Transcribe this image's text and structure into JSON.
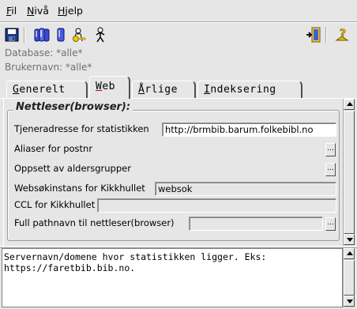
{
  "menu": {
    "file": {
      "u": "F",
      "rest": "il"
    },
    "level": {
      "u": "N",
      "rest": "ivå"
    },
    "help": {
      "u": "H",
      "rest": "jelp"
    }
  },
  "toolbar": {
    "icons": [
      "save-icon",
      "users-group-icon",
      "user-icon",
      "key-user-icon",
      "person-icon",
      "exit-door-icon",
      "help-icon"
    ]
  },
  "info": {
    "database": "Database: *alle*",
    "username": "Brukernavn: *alle*"
  },
  "tabs": [
    {
      "u": "G",
      "rest": "enerelt"
    },
    {
      "u": "W",
      "rest": "eb"
    },
    {
      "u": "Å",
      "rest": "rlige"
    },
    {
      "u": "I",
      "rest": "ndeksering"
    }
  ],
  "group": {
    "title": "Nettleser(browser):",
    "rows": [
      {
        "label": "Tjeneradresse for statistikken",
        "value": "http://brmbib.barum.folkebibl.no"
      },
      {
        "label": "Aliaser for postnr",
        "button": "..."
      },
      {
        "label": "Oppsett av aldersgrupper",
        "button": "..."
      },
      {
        "label": "Websøkinstans for Kikkhullet",
        "value": "websok"
      },
      {
        "label": "CCL for Kikkhullet",
        "value": ""
      },
      {
        "label": "Full pathnavn til nettleser(browser)",
        "value": "",
        "button": "..."
      }
    ]
  },
  "help_text": "Servernavn/domene hvor statistikken ligger. Eks:\nhttps://faretbib.bib.no."
}
